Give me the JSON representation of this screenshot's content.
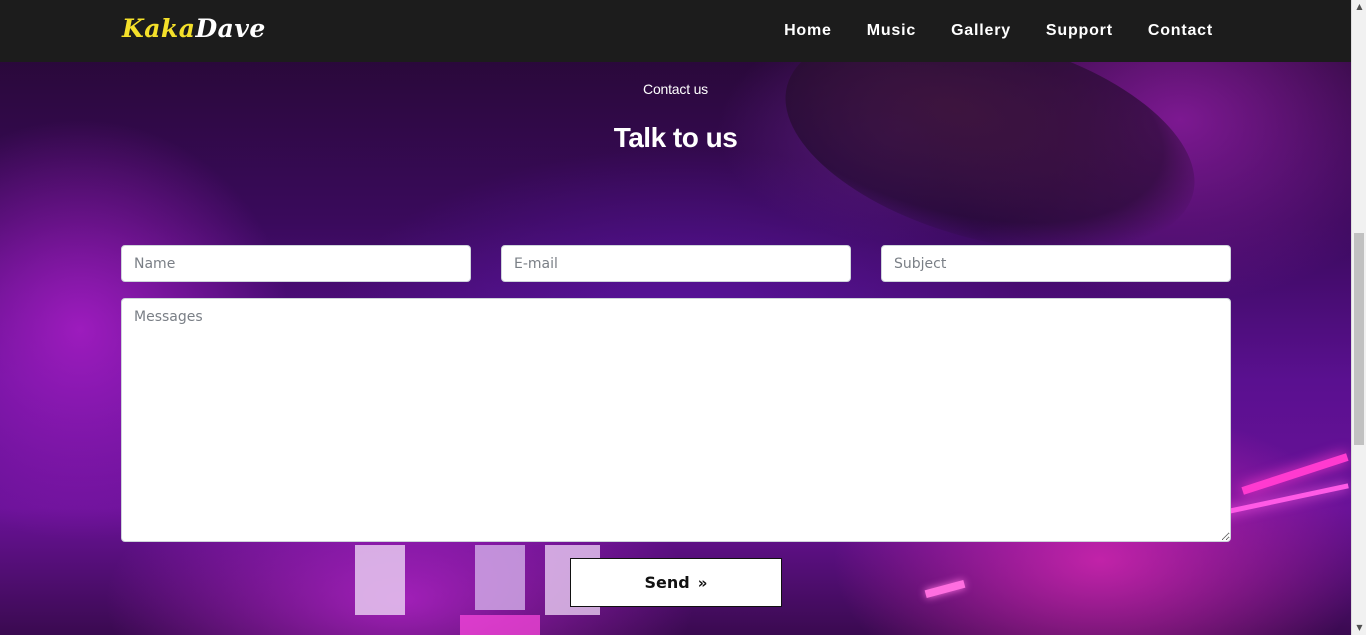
{
  "brand": {
    "part1": "Kaka",
    "part2": "Dave",
    "part1_color": "#f4e02a",
    "part2_color": "#ffffff"
  },
  "nav": {
    "items": [
      {
        "label": "Home"
      },
      {
        "label": "Music"
      },
      {
        "label": "Gallery"
      },
      {
        "label": "Support"
      },
      {
        "label": "Contact"
      }
    ]
  },
  "section": {
    "subtitle": "Contact us",
    "title": "Talk to us"
  },
  "form": {
    "name_placeholder": "Name",
    "email_placeholder": "E-mail",
    "subject_placeholder": "Subject",
    "message_placeholder": "Messages",
    "send_label": "Send",
    "send_icon": "double-chevron-right-icon"
  },
  "colors": {
    "navbar_bg": "#1c1c1c",
    "accent_yellow": "#f4e02a",
    "background_purple": "#5a1090"
  }
}
